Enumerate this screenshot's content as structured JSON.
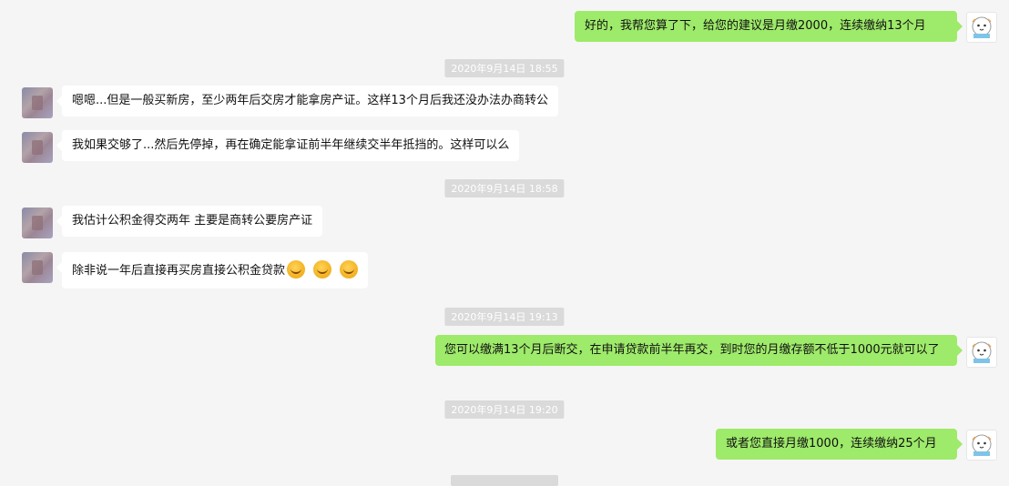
{
  "messages": [
    {
      "side": "right",
      "text": "好的，我帮您算了下，给您的建议是月缴2000，连续缴纳13个月"
    },
    {
      "side": "left",
      "text": "嗯嗯...但是一般买新房，至少两年后交房才能拿房产证。这样13个月后我还没办法办商转公"
    },
    {
      "side": "left",
      "text": "我如果交够了...然后先停掉，再在确定能拿证前半年继续交半年抵挡的。这样可以么"
    },
    {
      "side": "left",
      "text": "我估计公积金得交两年 主要是商转公要房产证"
    },
    {
      "side": "left",
      "text": "除非说一年后直接再买房直接公积金贷款"
    },
    {
      "side": "right",
      "text": "您可以缴满13个月后断交，在申请贷款前半年再交，到时您的月缴存额不低于1000元就可以了"
    },
    {
      "side": "right",
      "text": "或者您直接月缴1000，连续缴纳25个月"
    }
  ],
  "timestamps": [
    "2020年9月14日 18:55",
    "2020年9月14日 18:58",
    "2020年9月14日 19:13",
    "2020年9月14日 19:20"
  ],
  "emojis": [
    "facepalm-laugh-emoji",
    "facepalm-laugh-emoji",
    "facepalm-laugh-emoji"
  ],
  "avatars": {
    "self": "cartoon-avatar-icon",
    "other": "blurred-avatar"
  }
}
